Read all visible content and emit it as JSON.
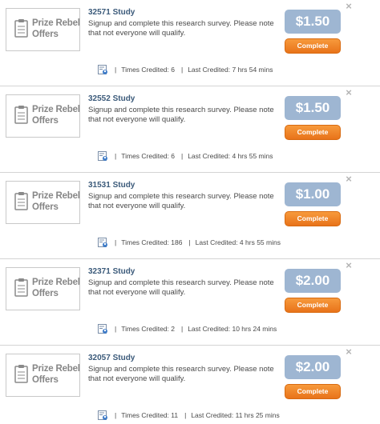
{
  "offers": [
    {
      "logo_text": "Prize Rebel Offers",
      "title": "32571 Study",
      "description": "Signup and complete this research survey. Please note that not everyone will qualify.",
      "price": "$1.50",
      "complete_label": "Complete",
      "times_credited": "Times Credited: 6",
      "last_credited": "Last Credited: 7 hrs 54 mins"
    },
    {
      "logo_text": "Prize Rebel Offers",
      "title": "32552 Study",
      "description": "Signup and complete this research survey. Please note that not everyone will qualify.",
      "price": "$1.50",
      "complete_label": "Complete",
      "times_credited": "Times Credited: 6",
      "last_credited": "Last Credited: 4 hrs 55 mins"
    },
    {
      "logo_text": "Prize Rebel Offers",
      "title": "31531 Study",
      "description": "Signup and complete this research survey. Please note that not everyone will qualify.",
      "price": "$1.00",
      "complete_label": "Complete",
      "times_credited": "Times Credited: 186",
      "last_credited": "Last Credited: 4 hrs 55 mins"
    },
    {
      "logo_text": "Prize Rebel Offers",
      "title": "32371 Study",
      "description": "Signup and complete this research survey. Please note that not everyone will qualify.",
      "price": "$2.00",
      "complete_label": "Complete",
      "times_credited": "Times Credited: 2",
      "last_credited": "Last Credited: 10 hrs 24 mins"
    },
    {
      "logo_text": "Prize Rebel Offers",
      "title": "32057 Study",
      "description": "Signup and complete this research survey. Please note that not everyone will qualify.",
      "price": "$2.00",
      "complete_label": "Complete",
      "times_credited": "Times Credited: 11",
      "last_credited": "Last Credited: 11 hrs 25 mins"
    }
  ],
  "icons": {
    "logo": "clipboard-icon",
    "credit": "user-stats-icon",
    "close": "close-icon"
  },
  "colors": {
    "price_badge": "#9eb6d2",
    "complete_button": "#f08a2a",
    "title": "#3b5a7a"
  }
}
